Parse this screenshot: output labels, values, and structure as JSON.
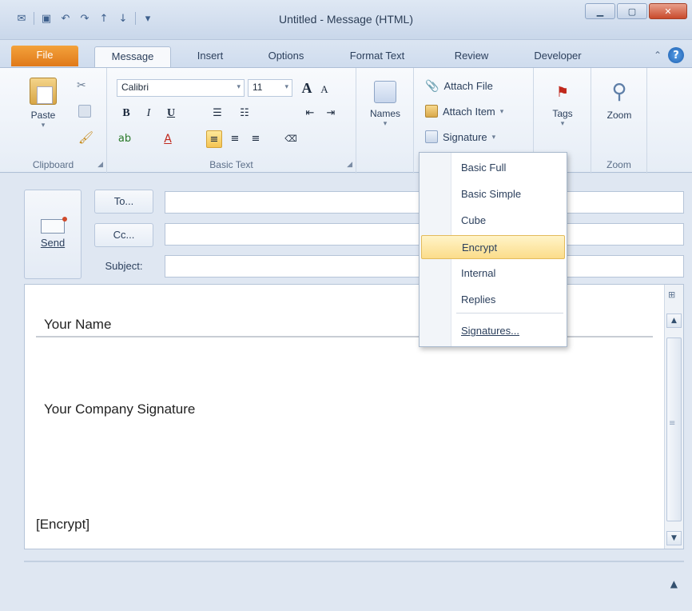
{
  "window": {
    "title": "Untitled - Message (HTML)"
  },
  "tabs": {
    "file": "File",
    "message": "Message",
    "insert": "Insert",
    "options": "Options",
    "format_text": "Format Text",
    "review": "Review",
    "developer": "Developer"
  },
  "ribbon": {
    "clipboard": {
      "group_label": "Clipboard",
      "paste": "Paste"
    },
    "basic_text": {
      "group_label": "Basic Text",
      "font_name": "Calibri",
      "font_size": "11",
      "bold": "B",
      "italic": "I",
      "underline": "U",
      "grow_font": "A",
      "shrink_font": "A"
    },
    "names": {
      "label": "Names"
    },
    "include": {
      "attach_file": "Attach File",
      "attach_item": "Attach Item",
      "signature": "Signature"
    },
    "tags": {
      "label": "Tags"
    },
    "zoom": {
      "label": "Zoom",
      "group_label": "Zoom"
    }
  },
  "signature_menu": {
    "items": [
      {
        "label": "Basic Full"
      },
      {
        "label": "Basic Simple"
      },
      {
        "label": "Cube"
      },
      {
        "label": "Encrypt"
      },
      {
        "label": "Internal"
      },
      {
        "label": "Replies"
      }
    ],
    "highlighted": "Encrypt",
    "manage": "Signatures..."
  },
  "compose": {
    "send": "Send",
    "to_button": "To...",
    "cc_button": "Cc...",
    "subject_label": "Subject:",
    "to_value": "",
    "cc_value": "",
    "subject_value": ""
  },
  "body": {
    "name_line": "Your Name",
    "company_line": "Your Company Signature",
    "tag_line": "[Encrypt]"
  },
  "colors": {
    "file_tab": "#e68a24",
    "accent_highlight": "#fbdc8a",
    "help_icon": "#1c5fb0"
  }
}
